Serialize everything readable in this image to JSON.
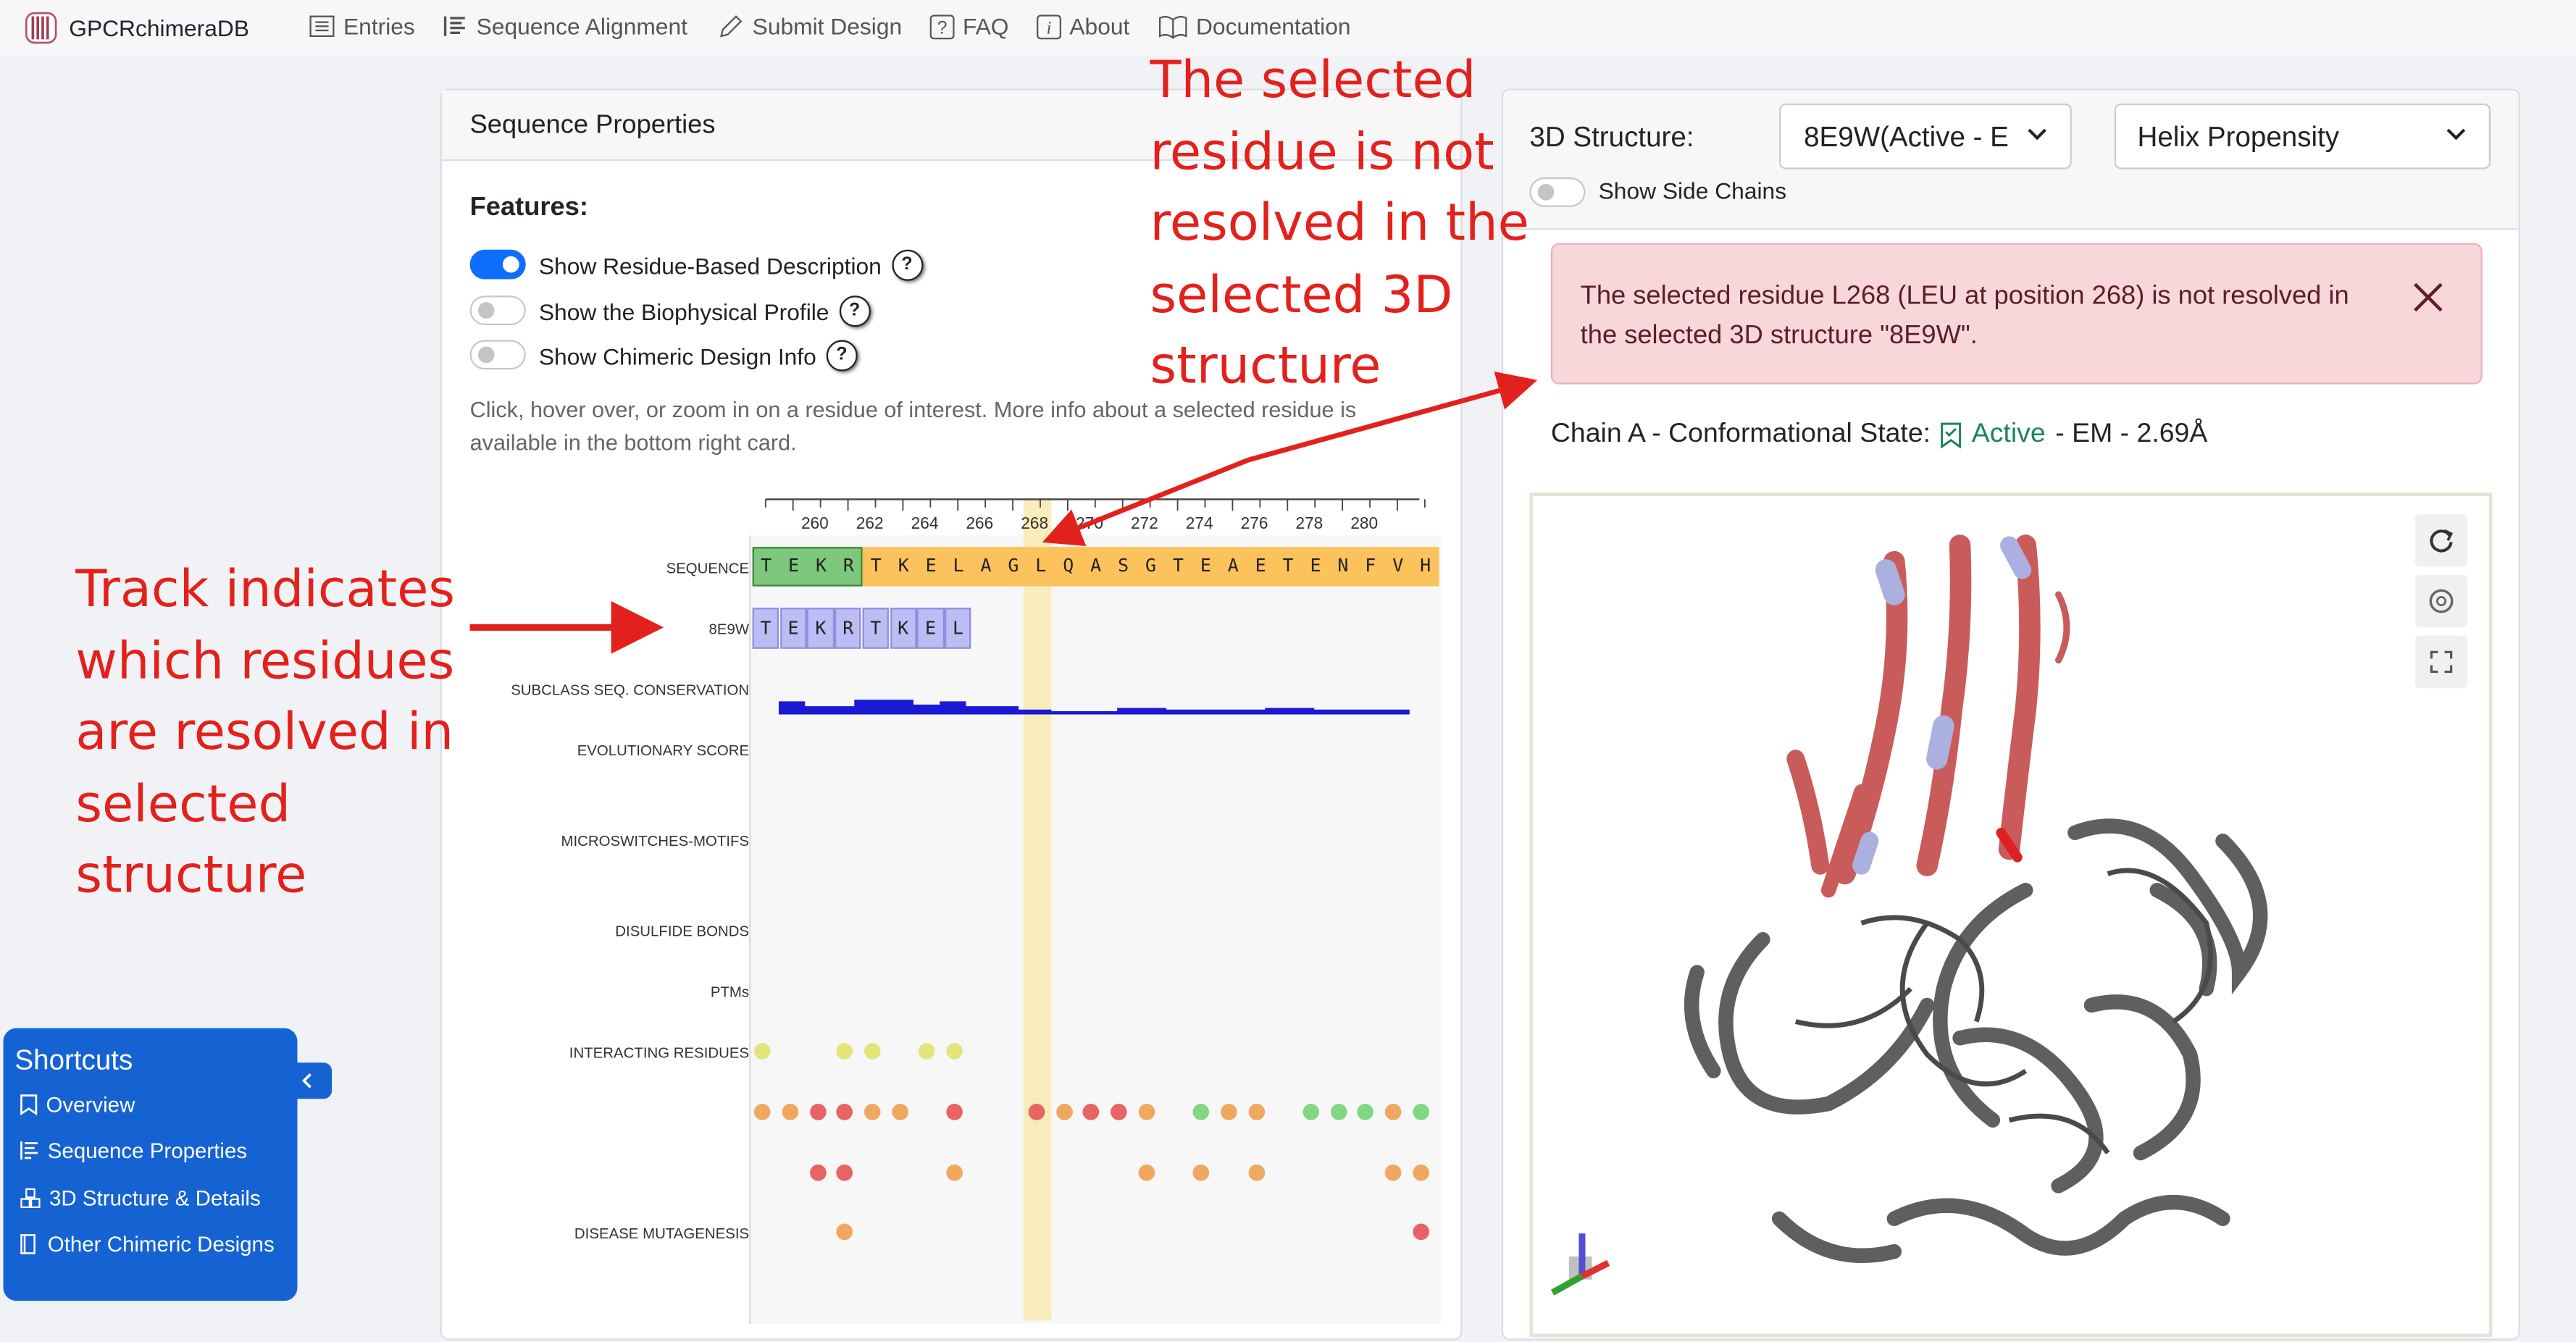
{
  "brand": {
    "name": "GPCRchimeraDB",
    "logo_icon": "logo-icon"
  },
  "nav": [
    {
      "label": "Entries",
      "icon": "list-icon"
    },
    {
      "label": "Sequence Alignment",
      "icon": "alignment-icon"
    },
    {
      "label": "Submit Design",
      "icon": "pencil-icon"
    },
    {
      "label": "FAQ",
      "icon": "question-icon"
    },
    {
      "label": "About",
      "icon": "info-icon"
    },
    {
      "label": "Documentation",
      "icon": "book-icon"
    }
  ],
  "seq_card": {
    "title": "Sequence Properties",
    "features_heading": "Features:",
    "features": [
      {
        "label": "Show Residue-Based Description",
        "on": true,
        "help": "?"
      },
      {
        "label": "Show the Biophysical Profile",
        "on": false,
        "help": "?"
      },
      {
        "label": "Show Chimeric Design Info",
        "on": false,
        "help": "?"
      }
    ],
    "hint": "Click, hover over, or zoom in on a residue of interest. More info about a selected residue is available in the bottom right card."
  },
  "viewer": {
    "ticks": [
      "260",
      "262",
      "264",
      "266",
      "268",
      "270",
      "272",
      "274",
      "276",
      "278",
      "280"
    ],
    "track_labels": {
      "sequence": "SEQUENCE",
      "structure": "8E9W",
      "conservation": "SUBCLASS SEQ. CONSERVATION",
      "evolutionary": "EVOLUTIONARY SCORE",
      "microswitches": "MICROSWITCHES-MOTIFS",
      "disulfide": "DISULFIDE BONDS",
      "ptms": "PTMs",
      "interacting": "INTERACTING RESIDUES",
      "disease": "DISEASE MUTAGENESIS"
    },
    "sequence": [
      "T",
      "E",
      "K",
      "R",
      "T",
      "K",
      "E",
      "L",
      "A",
      "G",
      "L",
      "Q",
      "A",
      "S",
      "G",
      "T",
      "E",
      "A",
      "E",
      "T",
      "E",
      "N",
      "F",
      "V",
      "H"
    ],
    "structure_residues": [
      "T",
      "E",
      "K",
      "R",
      "T",
      "K",
      "E",
      "L"
    ],
    "selected_residue_tick": "268",
    "colors": {
      "green": "#7ec87e",
      "orange": "#fcc35c",
      "lavender": "#bdbdf5",
      "highlight": "#f8eab0",
      "bar": "#1a1ad6"
    }
  },
  "structure_card": {
    "label": "3D Structure:",
    "structure_select": "8E9W(Active - E",
    "property_select": "Helix Propensity",
    "side_chains": "Show Side Chains",
    "alert": "The selected residue L268 (LEU at position 268) is not resolved in the selected 3D structure \"8E9W\".",
    "chain_prefix": "Chain A - Conformational State:",
    "state": "Active",
    "suffix": "- EM - 2.69Å",
    "viewer_icons": [
      "refresh-icon",
      "camera-icon",
      "expand-icon"
    ]
  },
  "shortcuts": {
    "title": "Shortcuts",
    "items": [
      {
        "label": "Overview",
        "icon": "bookmark-icon"
      },
      {
        "label": "Sequence Properties",
        "icon": "bars-icon"
      },
      {
        "label": "3D Structure & Details",
        "icon": "cubes-icon"
      },
      {
        "label": "Other Chimeric Designs",
        "icon": "book-icon"
      }
    ]
  },
  "annotations": {
    "left": [
      "Track indicates",
      "which residues",
      "are resolved in",
      "selected",
      "structure"
    ],
    "top": [
      "The selected",
      "residue is not",
      "resolved in the",
      "selected 3D",
      "structure"
    ]
  }
}
